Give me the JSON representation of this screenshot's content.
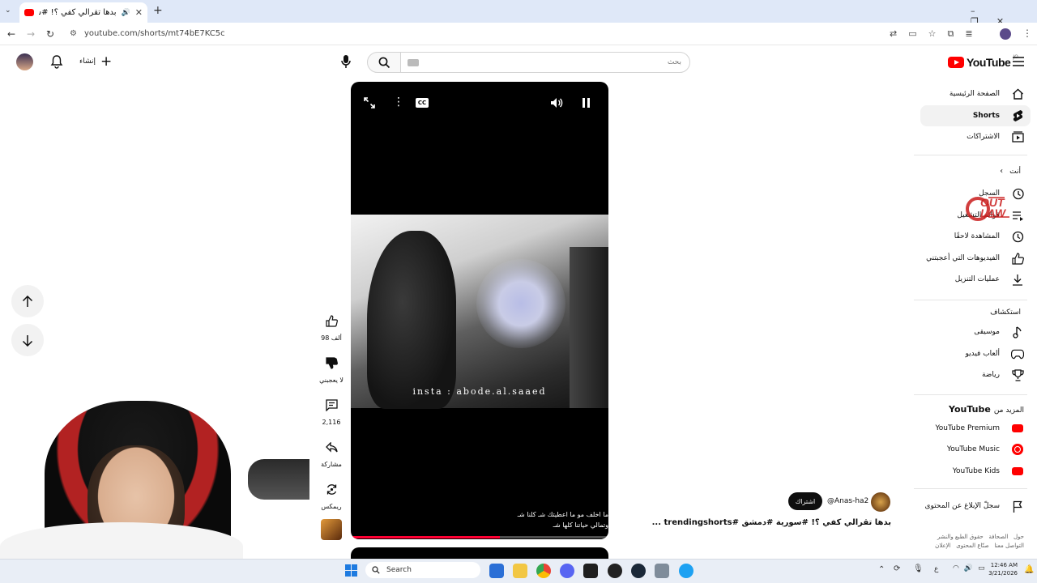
{
  "browser": {
    "tab_title": "بدها تقرالي كفي ؟! #سورية",
    "url": "youtube.com/shorts/mt74bE7KC5c"
  },
  "header": {
    "create_label": "إنشاء",
    "search_placeholder": "بحث",
    "logo_text": "YouTube",
    "logo_badge": "JO"
  },
  "sidebar": {
    "main": [
      {
        "label": "الصفحة الرئيسية",
        "icon": "home-icon"
      },
      {
        "label": "Shorts",
        "icon": "shorts-icon",
        "active": true
      },
      {
        "label": "الاشتراكات",
        "icon": "subscriptions-icon"
      }
    ],
    "you_title": "أنت",
    "you": [
      {
        "label": "السجل",
        "icon": "history-icon"
      },
      {
        "label": "قوائم التشغيل",
        "icon": "playlists-icon"
      },
      {
        "label": "المشاهدة لاحقًا",
        "icon": "watch-later-icon"
      },
      {
        "label": "الفيديوهات التي أعجبتني",
        "icon": "like-icon"
      },
      {
        "label": "عمليات التنزيل",
        "icon": "download-icon"
      }
    ],
    "explore_title": "استكشاف",
    "explore": [
      {
        "label": "موسيقى",
        "icon": "music-icon"
      },
      {
        "label": "ألعاب فيديو",
        "icon": "gaming-icon"
      },
      {
        "label": "رياضة",
        "icon": "sports-icon"
      }
    ],
    "more_title_ar": "المزيد من",
    "more_title_en": "YouTube",
    "more": [
      {
        "label": "YouTube Premium",
        "color": "#ff0000"
      },
      {
        "label": "YouTube Music",
        "color": "#ff0000"
      },
      {
        "label": "YouTube Kids",
        "color": "#ff0000"
      }
    ],
    "report_label": "سجلّ الإبلاغ عن المحتوى",
    "footer_line1": "حول   الصحافة   حقوق الطبع والنشر",
    "footer_line2": "التواصل معنا   صنّاع المحتوى   الإعلان",
    "watermark_text": "OUT LAW"
  },
  "short": {
    "overlay_text": "insta : abode.al.saaed",
    "caption_line1": "ما اخلف مو ما اعطيتك شـ كلنا شـ",
    "caption_line2": "وتمالي حياتنا كلها شـ",
    "progress": 0.58,
    "channel": "@Anas-ha2",
    "subscribe_label": "اشتراك",
    "title": "بدها تقرالي كفي ؟! #سورية #دمشق #trendingshorts ..."
  },
  "actions": {
    "likes": "98 ألف",
    "dislike_label": "لا يعجبني",
    "comments": "2,116",
    "share_label": "مشاركة",
    "remix_label": "ريمكس"
  },
  "taskbar": {
    "search_label": "Search",
    "lang": "ع",
    "time": "12:46 AM",
    "date": "3/21/2026"
  }
}
